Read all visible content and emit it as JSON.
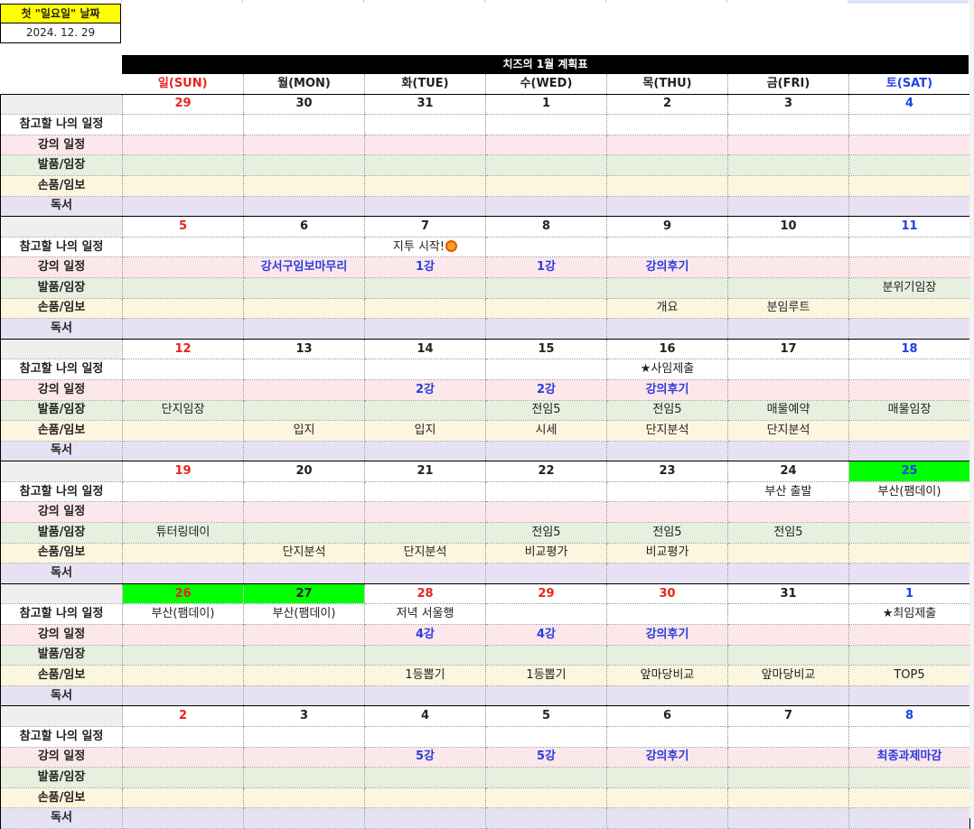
{
  "header": {
    "first_sunday_label": "첫 \"일요일\" 날짜",
    "first_sunday_date": "2024. 12. 29",
    "title": "치즈의 1월 계획표"
  },
  "days": [
    "일(SUN)",
    "월(MON)",
    "화(TUE)",
    "수(WED)",
    "목(THU)",
    "금(FRI)",
    "토(SAT)"
  ],
  "row_labels": [
    "참고할 나의 일정",
    "강의 일정",
    "발품/임장",
    "손품/임보",
    "독서"
  ],
  "colors": {
    "sunday": "#e8231f",
    "saturday": "#1f3fe8",
    "lecture": "#2a3ce0",
    "highlight": "#00ff00",
    "title_bg": "#000000"
  },
  "weeks": [
    {
      "dates": [
        "29",
        "30",
        "31",
        "1",
        "2",
        "3",
        "4"
      ],
      "rows": [
        [
          "",
          "",
          "",
          "",
          "",
          "",
          ""
        ],
        [
          "",
          "",
          "",
          "",
          "",
          "",
          ""
        ],
        [
          "",
          "",
          "",
          "",
          "",
          "",
          ""
        ],
        [
          "",
          "",
          "",
          "",
          "",
          "",
          ""
        ],
        [
          "",
          "",
          "",
          "",
          "",
          "",
          ""
        ]
      ]
    },
    {
      "dates": [
        "5",
        "6",
        "7",
        "8",
        "9",
        "10",
        "11"
      ],
      "rows": [
        [
          "",
          "",
          "지투 시작!",
          "",
          "",
          "",
          ""
        ],
        [
          "",
          "강서구임보마무리",
          "1강",
          "1강",
          "강의후기",
          "",
          ""
        ],
        [
          "",
          "",
          "",
          "",
          "",
          "",
          "분위기임장"
        ],
        [
          "",
          "",
          "",
          "",
          "개요",
          "분임루트",
          ""
        ],
        [
          "",
          "",
          "",
          "",
          "",
          "",
          ""
        ]
      ]
    },
    {
      "dates": [
        "12",
        "13",
        "14",
        "15",
        "16",
        "17",
        "18"
      ],
      "rows": [
        [
          "",
          "",
          "",
          "",
          "★사임제출",
          "",
          ""
        ],
        [
          "",
          "",
          "2강",
          "2강",
          "강의후기",
          "",
          ""
        ],
        [
          "단지임장",
          "",
          "",
          "전임5",
          "전임5",
          "매물예약",
          "매물임장"
        ],
        [
          "",
          "입지",
          "입지",
          "시세",
          "단지분석",
          "단지분석",
          ""
        ],
        [
          "",
          "",
          "",
          "",
          "",
          "",
          ""
        ]
      ]
    },
    {
      "dates": [
        "19",
        "20",
        "21",
        "22",
        "23",
        "24",
        "25"
      ],
      "rows": [
        [
          "",
          "",
          "",
          "",
          "",
          "부산 출발",
          "부산(팸데이)"
        ],
        [
          "",
          "",
          "",
          "",
          "",
          "",
          ""
        ],
        [
          "튜터링데이",
          "",
          "",
          "전임5",
          "전임5",
          "전임5",
          ""
        ],
        [
          "",
          "단지분석",
          "단지분석",
          "비교평가",
          "비교평가",
          "",
          ""
        ],
        [
          "",
          "",
          "",
          "",
          "",
          "",
          ""
        ]
      ]
    },
    {
      "dates": [
        "26",
        "27",
        "28",
        "29",
        "30",
        "31",
        "1"
      ],
      "rows": [
        [
          "부산(팸데이)",
          "부산(팸데이)",
          "저녁 서울행",
          "",
          "",
          "",
          "★최임제출"
        ],
        [
          "",
          "",
          "4강",
          "4강",
          "강의후기",
          "",
          ""
        ],
        [
          "",
          "",
          "",
          "",
          "",
          "",
          ""
        ],
        [
          "",
          "",
          "1등뽑기",
          "1등뽑기",
          "앞마당비교",
          "앞마당비교",
          "TOP5"
        ],
        [
          "",
          "",
          "",
          "",
          "",
          "",
          ""
        ]
      ]
    },
    {
      "dates": [
        "2",
        "3",
        "4",
        "5",
        "6",
        "7",
        "8"
      ],
      "rows": [
        [
          "",
          "",
          "",
          "",
          "",
          "",
          ""
        ],
        [
          "",
          "",
          "5강",
          "5강",
          "강의후기",
          "",
          "최종과제마감"
        ],
        [
          "",
          "",
          "",
          "",
          "",
          "",
          ""
        ],
        [
          "",
          "",
          "",
          "",
          "",
          "",
          ""
        ],
        [
          "",
          "",
          "",
          "",
          "",
          "",
          ""
        ]
      ]
    }
  ]
}
